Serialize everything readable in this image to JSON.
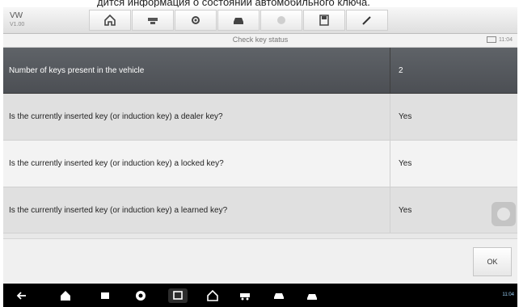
{
  "caption": "дится информация о состоянии автомобильного ключа.",
  "brand": {
    "name": "VW",
    "version": "V1.00"
  },
  "toolbar_icons": [
    "home-icon",
    "vci-icon",
    "settings-icon",
    "car-icon",
    "print-icon",
    "save-icon",
    "edit-icon"
  ],
  "screen_title": "Check key status",
  "status_bar_text": "11:04",
  "table": {
    "header": {
      "label": "Number of keys present in the vehicle",
      "value": "2"
    },
    "rows": [
      {
        "label": "Is the currently inserted key (or induction key) a dealer key?",
        "value": "Yes"
      },
      {
        "label": "Is the currently inserted key (or induction key) a locked key?",
        "value": "Yes"
      },
      {
        "label": "Is the currently inserted key (or induction key) a learned key?",
        "value": "Yes"
      }
    ]
  },
  "ok_button": "OK",
  "nav_icons": [
    "back-icon",
    "home-icon",
    "recent-apps-icon",
    "chrome-icon",
    "screenshot-icon",
    "house-icon",
    "vci-icon",
    "car-icon",
    "vehicle-switch-icon"
  ],
  "system_status": "11:04"
}
